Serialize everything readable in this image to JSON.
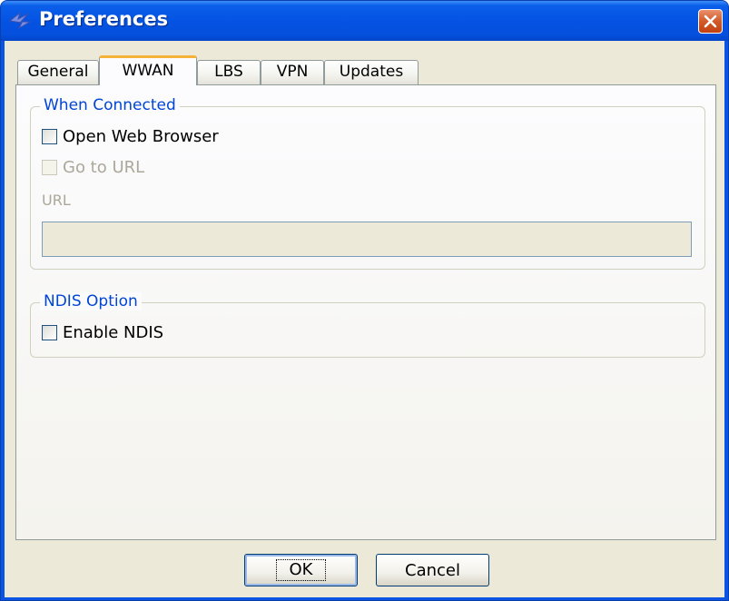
{
  "window": {
    "title": "Preferences",
    "app_icon": "satellite-logo-icon",
    "close_icon": "close-icon"
  },
  "tabs": [
    {
      "label": "General",
      "active": false
    },
    {
      "label": "WWAN",
      "active": true
    },
    {
      "label": "LBS",
      "active": false
    },
    {
      "label": "VPN",
      "active": false
    },
    {
      "label": "Updates",
      "active": false
    }
  ],
  "when_connected": {
    "label": "When Connected",
    "open_browser": {
      "label": "Open Web Browser",
      "checked": false,
      "enabled": true
    },
    "go_to_url": {
      "label": "Go to URL",
      "checked": false,
      "enabled": false
    },
    "url": {
      "label": "URL",
      "value": "",
      "enabled": false
    }
  },
  "ndis": {
    "label": "NDIS Option",
    "enable_ndis": {
      "label": "Enable NDIS",
      "checked": false,
      "enabled": true
    }
  },
  "buttons": {
    "ok": "OK",
    "cancel": "Cancel"
  },
  "colors": {
    "title_bar": "#0553e3",
    "close_button": "#d25a2a",
    "active_tab_accent": "#f5b23b",
    "group_label": "#0046d5",
    "disabled_text": "#aca899"
  }
}
